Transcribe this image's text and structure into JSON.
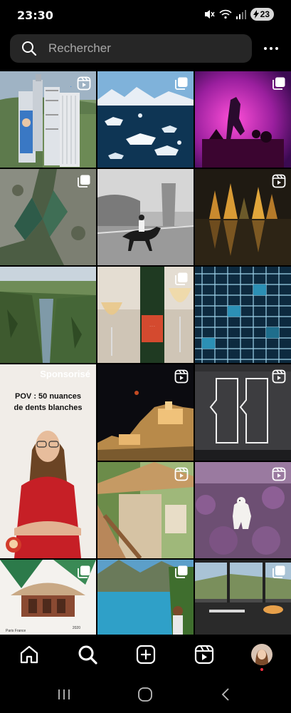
{
  "status": {
    "time": "23:30",
    "battery": "23"
  },
  "search": {
    "placeholder": "Rechercher"
  },
  "sponsored": {
    "label": "Sponsorisé",
    "text_line1": "POV : 50 nuances",
    "text_line2": "de dents blanches"
  },
  "tile_captions": {
    "location": "Paris\nFrance",
    "year": "2020"
  },
  "tiles": [
    {
      "name": "explore-post-tower",
      "badge": "reels-icon"
    },
    {
      "name": "explore-post-icebergs",
      "badge": "carousel-icon"
    },
    {
      "name": "explore-post-concert",
      "badge": "carousel-icon"
    },
    {
      "name": "explore-post-aerial-rocks",
      "badge": "carousel-icon"
    },
    {
      "name": "explore-post-horse-rider",
      "badge": "none"
    },
    {
      "name": "explore-post-autumn-lake",
      "badge": "reels-icon"
    },
    {
      "name": "explore-post-canyon",
      "badge": "none"
    },
    {
      "name": "explore-post-wine",
      "badge": "carousel-icon"
    },
    {
      "name": "explore-post-building-facade",
      "badge": "none"
    },
    {
      "name": "explore-post-sponsored",
      "badge": "none"
    },
    {
      "name": "explore-post-night-castle",
      "badge": "reels-icon"
    },
    {
      "name": "explore-post-grey-doors",
      "badge": "reels-icon"
    },
    {
      "name": "explore-post-pergola",
      "badge": "reels-icon"
    },
    {
      "name": "explore-post-dog-heather",
      "badge": "reels-icon"
    },
    {
      "name": "explore-post-pavilion",
      "badge": "carousel-icon"
    },
    {
      "name": "explore-post-mountain-lake",
      "badge": "carousel-icon"
    },
    {
      "name": "explore-post-terrace-restaurant",
      "badge": "carousel-icon"
    }
  ],
  "nav": {
    "items": [
      "home-icon",
      "search-icon",
      "create-icon",
      "reels-icon",
      "profile-avatar"
    ]
  },
  "colors": {
    "background": "#000000",
    "search_field": "#262626",
    "placeholder": "#a8a8a8",
    "notification": "#ff3040"
  }
}
